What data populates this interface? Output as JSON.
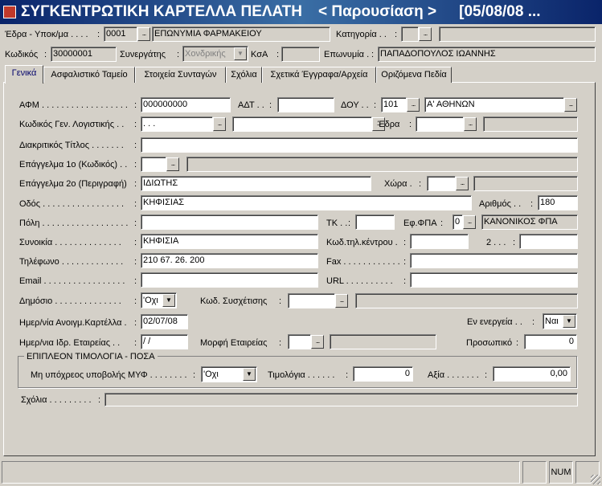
{
  "window": {
    "title_main": "ΣΥΓΚΕΝΤΡΩΤΙΚΗ ΚΑΡΤΕΛΛΑ ΠΕΛΑΤΗ",
    "title_mode": "< Παρουσίαση >",
    "title_date": "[05/08/08 ..."
  },
  "header": {
    "edra_label": "Έδρα - Υποκ/μα . . . .",
    "edra_code": "0001",
    "edra_name": "ΕΠΩΝΥΜΙΑ ΦΑΡΜΑΚΕΙΟΥ",
    "kategoria_label": "Κατηγορία . .",
    "kategoria_code": "",
    "kategoria_name": "",
    "kodikos_label": "Κωδικός",
    "kodikos_value": "30000001",
    "synergatis_label": "Συνεργάτης",
    "synergatis_value": "Χονδρικής",
    "ksa_label": "ΚσΑ",
    "ksa_value": "",
    "eponymia_label": "Επωνυμία .",
    "eponymia_value": "ΠΑΠΑΔΟΠΟΥΛΟΣ ΙΩΑΝΝΗΣ"
  },
  "tabs": [
    {
      "label": "Γενικά",
      "active": true
    },
    {
      "label": "Ασφαλιστικό Ταμείο",
      "active": false
    },
    {
      "label": "Στοιχεία Συνταγών",
      "active": false
    },
    {
      "label": "Σχόλια",
      "active": false
    },
    {
      "label": "Σχετικά Έγγραφα/Αρχεία",
      "active": false
    },
    {
      "label": "Οριζόμενα Πεδία",
      "active": false
    }
  ],
  "form": {
    "afm_label": "ΑΦΜ . . . . . . . . . . . . . . . . . .",
    "afm_value": "000000000",
    "adt_label": "ΑΔΤ . .",
    "adt_value": "",
    "doy_label": "ΔΟΥ . .",
    "doy_code": "101",
    "doy_name": "Α' ΑΘΗΝΩΝ",
    "kodgen_label": "Κωδικός Γεν. Λογιστικής . .",
    "kodgen_value": ". . .",
    "kodgen_desc": "",
    "edra2_label": "Έδρα",
    "edra2_code": "",
    "edra2_name": "",
    "diakr_label": "Διακριτικός Τίτλος . . . . . . .",
    "diakr_value": "",
    "epag1_label": "Επάγγελμα 1ο (Κωδικός) . .",
    "epag1_code": "",
    "epag1_name": "",
    "epag2_label": "Επάγγελμα 2ο (Περιγραφή)",
    "epag2_value": "ΙΔΙΩΤΗΣ",
    "xora_label": "Χώρα .",
    "xora_code": "",
    "xora_name": "",
    "odos_label": "Οδός . . . . . . . . . . . . . . . . .",
    "odos_value": "ΚΗΦΙΣΙΑΣ",
    "arithmos_label": "Αριθμός . .",
    "arithmos_value": "180",
    "poli_label": "Πόλη . . . . . . . . . . . . . . . . . .",
    "poli_value": "",
    "tk_label": "ΤΚ . .",
    "tk_value": "",
    "efpa_label": "Εφ.ΦΠΑ",
    "efpa_code": "0",
    "efpa_name": "ΚΑΝΟΝΙΚΟΣ ΦΠΑ",
    "synoikia_label": "Συνοικία . . . . . . . . . . . . . .",
    "synoikia_value": "ΚΗΦΙΣΙΑ",
    "kodtil_label": "Κωδ.τηλ.κέντρου .",
    "kodtil_value": "",
    "two_label": "2 . . .",
    "two_value": "",
    "tilefono_label": "Τηλέφωνο . . . . . . . . . . . . .",
    "tilefono_value": "210 67. 26. 200",
    "fax_label": "Fax . . . . . . . . . . . .",
    "fax_value": "",
    "email_label": "Email . . . . . . . . . . . . . . . . .",
    "email_value": "",
    "url_label": "URL . . . . . . . . . .",
    "url_value": "",
    "dimosio_label": "Δημόσιο . . . . . . . . . . . . . .",
    "dimosio_value": "'Οχι",
    "kodsys_label": "Κωδ. Συσχέτισης",
    "kodsys_code": "",
    "kodsys_name": "",
    "imerkart_label": "Ημερ/νία Ανοιγμ.Καρτέλλα .",
    "imerkart_value": "02/07/08",
    "energeia_label": "Εν ενεργεία . .",
    "energeia_value": "Ναι",
    "imeridr_label": "Ημερ/νια Ιδρ. Εταιρείας . .",
    "imeridr_value": " /  /",
    "morfi_label": "Μορφή Εταιρείας",
    "morfi_code": "",
    "morfi_name": "",
    "prosopiko_label": "Προσωπικό",
    "prosopiko_value": "0",
    "group_title": "ΕΠΙΠΛΕΟΝ ΤΙΜΟΛΟΓΙΑ - ΠΟΣΑ",
    "myf_label": "Μη υπόχρεος υποβολής ΜΥΦ . . . . . . . .",
    "myf_value": "'Οχι",
    "timologia_label": "Τιμολόγια . . . . . .",
    "timologia_value": "0",
    "axia_label": "Αξία . . . . . . .",
    "axia_value": "0,00",
    "sxolia_label": "Σχόλια . . . . . . . . .",
    "sxolia_value": ""
  },
  "status": {
    "num": "NUM"
  }
}
